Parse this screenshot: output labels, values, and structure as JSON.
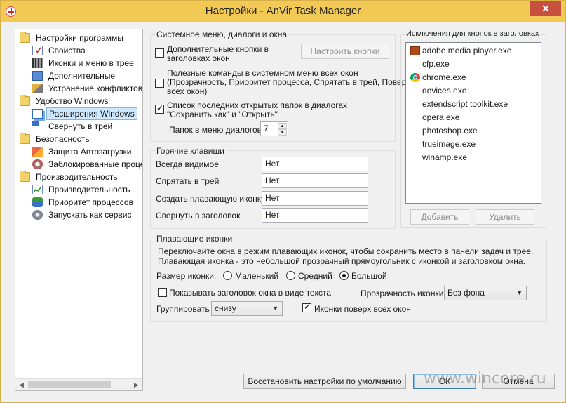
{
  "window": {
    "title": "Настройки - AnVir Task Manager",
    "close_glyph": "✕"
  },
  "tree": {
    "items": [
      {
        "label": "Настройки программы",
        "icon": "folder-icon"
      },
      {
        "label": "Свойства",
        "icon": "properties-icon"
      },
      {
        "label": "Иконки и меню в трее",
        "icon": "tray-icons-icon"
      },
      {
        "label": "Дополнительные",
        "icon": "additional-icon"
      },
      {
        "label": "Устранение конфликтов",
        "icon": "conflicts-icon"
      },
      {
        "label": "Удобство Windows",
        "icon": "folder-icon"
      },
      {
        "label": "Расширения Windows",
        "icon": "windows-extensions-icon",
        "selected": true
      },
      {
        "label": "Свернуть в трей",
        "icon": "minimize-tray-icon"
      },
      {
        "label": "Безопасность",
        "icon": "folder-icon"
      },
      {
        "label": "Защита Автозагрузки",
        "icon": "startup-protection-icon"
      },
      {
        "label": "Заблокированные проце",
        "icon": "blocked-processes-icon"
      },
      {
        "label": "Производительность",
        "icon": "folder-icon"
      },
      {
        "label": "Производительность",
        "icon": "performance-icon"
      },
      {
        "label": "Приоритет процессов",
        "icon": "process-priority-icon"
      },
      {
        "label": "Запускать как сервис",
        "icon": "service-icon"
      }
    ],
    "scroll_left": "◀",
    "scroll_right": "▶"
  },
  "sysmenu": {
    "title": "Системное меню, диалоги и окна",
    "extra_buttons_label": "Дополнительные кнопки в\nзаголовках окон",
    "extra_buttons_checked": false,
    "configure_button": "Настроить кнопки",
    "useful_commands_label": "Полезные команды в системном меню всех окон\n(Прозрачность, Приоритет процесса, Спрятать в трей, Поверх\nвсех окон)",
    "useful_commands_checked": false,
    "recent_folders_label": "Список последних открытых папок в диалогах\n\"Сохранить как\" и \"Открыть\"",
    "recent_folders_checked": true,
    "folders_count_label": "Папок в меню диалогов:",
    "folders_count_value": "7",
    "spin_up": "▲",
    "spin_down": "▼"
  },
  "hotkeys": {
    "title": "Горячие клавиши",
    "rows": [
      {
        "label": "Всегда видимое",
        "value": "Нет"
      },
      {
        "label": "Спрятать в трей",
        "value": "Нет"
      },
      {
        "label": "Создать плавающую иконку",
        "value": "Нет"
      },
      {
        "label": "Свернуть в заголовок",
        "value": "Нет"
      }
    ]
  },
  "exceptions": {
    "title": "Исключения для кнопок в заголовках",
    "items": [
      {
        "label": "adobe media player.exe",
        "icon": "adobe-media-player-icon"
      },
      {
        "label": "cfp.exe",
        "icon": ""
      },
      {
        "label": "chrome.exe",
        "icon": "chrome-icon"
      },
      {
        "label": "devices.exe",
        "icon": ""
      },
      {
        "label": "extendscript toolkit.exe",
        "icon": ""
      },
      {
        "label": "opera.exe",
        "icon": ""
      },
      {
        "label": "photoshop.exe",
        "icon": ""
      },
      {
        "label": "trueimage.exe",
        "icon": ""
      },
      {
        "label": "winamp.exe",
        "icon": ""
      }
    ],
    "add_button": "Добавить",
    "remove_button": "Удалить"
  },
  "floating": {
    "title": "Плавающие иконки",
    "description": "Переключайте окна в режим плавающих иконок, чтобы сохранить место в панели задач и трее.\nПлавающая иконка - это небольшой прозрачный прямоугольник с иконкой и заголовком окна.",
    "size_label": "Размер иконки:",
    "size_options": [
      {
        "label": "Маленький",
        "checked": false
      },
      {
        "label": "Средний",
        "checked": false
      },
      {
        "label": "Большой",
        "checked": true
      }
    ],
    "show_title_label": "Показывать заголовок окна в виде текста",
    "show_title_checked": false,
    "transparency_label": "Прозрачность иконки",
    "transparency_value": "Без фона",
    "group_label": "Группировать",
    "group_value": "снизу",
    "on_top_label": "Иконки поверх всех окон",
    "on_top_checked": true,
    "dropdown_arrow": "▼"
  },
  "footer": {
    "restore_button": "Восстановить настройки по умолчанию",
    "ok_button": "ОК",
    "cancel_button": "Отмена",
    "watermark": "www.wincore.ru"
  }
}
